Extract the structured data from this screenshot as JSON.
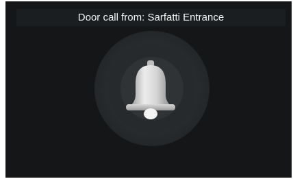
{
  "call": {
    "title": "Door call from: Sarfatti Entrance"
  },
  "icons": {
    "bell": "bell-icon"
  },
  "colors": {
    "background": "#141617",
    "title_bar": "#1b1e20",
    "text": "#f2f2f2",
    "bell": "#d0d0d0"
  }
}
